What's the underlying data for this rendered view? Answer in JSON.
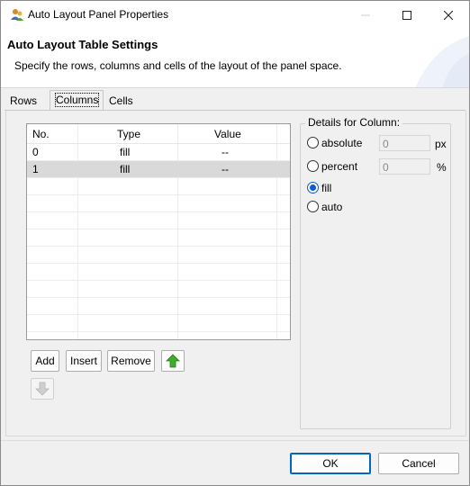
{
  "window": {
    "title": "Auto Layout Panel Properties"
  },
  "banner": {
    "title": "Auto Layout Table Settings",
    "description": "Specify the rows, columns and cells of the layout of the panel space."
  },
  "tabs": [
    {
      "label": "Rows",
      "selected": false
    },
    {
      "label": "Columns",
      "selected": true
    },
    {
      "label": "Cells",
      "selected": false
    }
  ],
  "table": {
    "headers": [
      "No.",
      "Type",
      "Value"
    ],
    "rows": [
      {
        "no": "0",
        "type": "fill",
        "value": "--",
        "selected": false
      },
      {
        "no": "1",
        "type": "fill",
        "value": "--",
        "selected": true
      }
    ]
  },
  "buttons": {
    "add": "Add",
    "insert": "Insert",
    "remove": "Remove"
  },
  "details": {
    "legend": "Details for Column:",
    "options": [
      {
        "label": "absolute",
        "checked": false,
        "value": "0",
        "unit": "px"
      },
      {
        "label": "percent",
        "checked": false,
        "value": "0",
        "unit": "%"
      },
      {
        "label": "fill",
        "checked": true
      },
      {
        "label": "auto",
        "checked": false
      }
    ]
  },
  "footer": {
    "ok": "OK",
    "cancel": "Cancel"
  },
  "colors": {
    "accent": "#0a5bd6",
    "selection": "#d9d9d9",
    "arrow_green": "#3fae2a"
  }
}
